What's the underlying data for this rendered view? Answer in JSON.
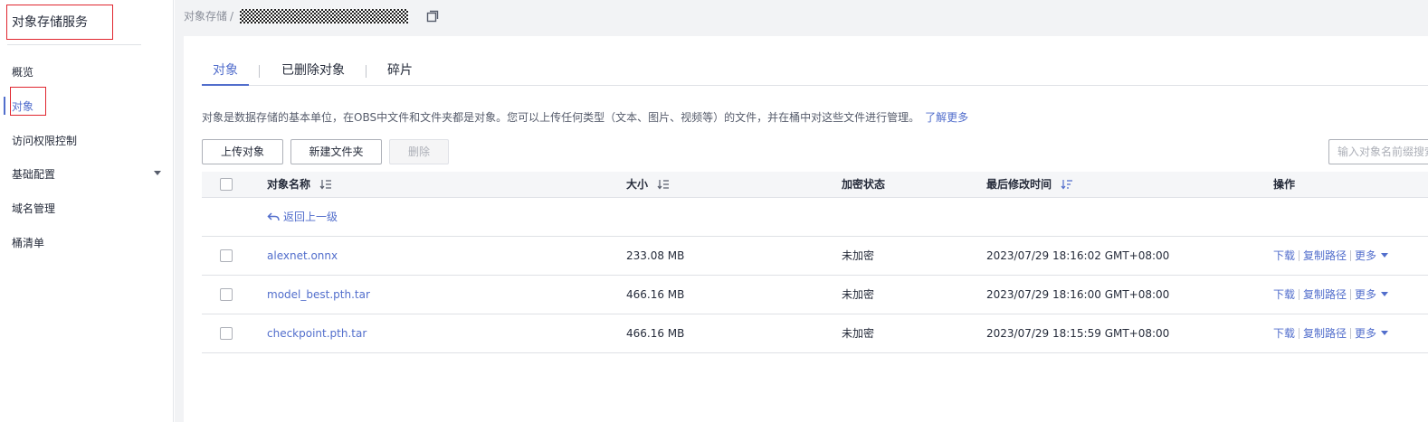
{
  "sidebar": {
    "title": "对象存储服务",
    "items": [
      {
        "label": "概览"
      },
      {
        "label": "对象"
      },
      {
        "label": "访问权限控制"
      },
      {
        "label": "基础配置"
      },
      {
        "label": "域名管理"
      },
      {
        "label": "桶清单"
      }
    ]
  },
  "breadcrumb": {
    "root": "对象存储",
    "separator": "/"
  },
  "tabs": [
    {
      "label": "对象"
    },
    {
      "label": "已删除对象"
    },
    {
      "label": "碎片"
    }
  ],
  "description": {
    "text": "对象是数据存储的基本单位，在OBS中文件和文件夹都是对象。您可以上传任何类型（文本、图片、视频等）的文件，并在桶中对这些文件进行管理。",
    "learn_more": "了解更多"
  },
  "toolbar": {
    "upload": "上传对象",
    "new_folder": "新建文件夹",
    "delete": "删除",
    "search_placeholder": "输入对象名前缀搜索"
  },
  "table": {
    "headers": {
      "name": "对象名称",
      "size": "大小",
      "encryption": "加密状态",
      "modified": "最后修改时间",
      "actions": "操作"
    },
    "back_label": "返回上一级",
    "rows": [
      {
        "name": "alexnet.onnx",
        "size": "233.08 MB",
        "encryption": "未加密",
        "modified": "2023/07/29 18:16:02 GMT+08:00",
        "download": "下载",
        "copy_path": "复制路径",
        "more": "更多"
      },
      {
        "name": "model_best.pth.tar",
        "size": "466.16 MB",
        "encryption": "未加密",
        "modified": "2023/07/29 18:16:00 GMT+08:00",
        "download": "下载",
        "copy_path": "复制路径",
        "more": "更多"
      },
      {
        "name": "checkpoint.pth.tar",
        "size": "466.16 MB",
        "encryption": "未加密",
        "modified": "2023/07/29 18:15:59 GMT+08:00",
        "download": "下载",
        "copy_path": "复制路径",
        "more": "更多"
      }
    ]
  },
  "colors": {
    "accent": "#526ecc",
    "highlight_box": "#e0262f",
    "page_bg": "#f2f3f5"
  },
  "icons": [
    "copy-icon",
    "sort-icon",
    "back-arrow-icon",
    "chevron-down-icon"
  ]
}
